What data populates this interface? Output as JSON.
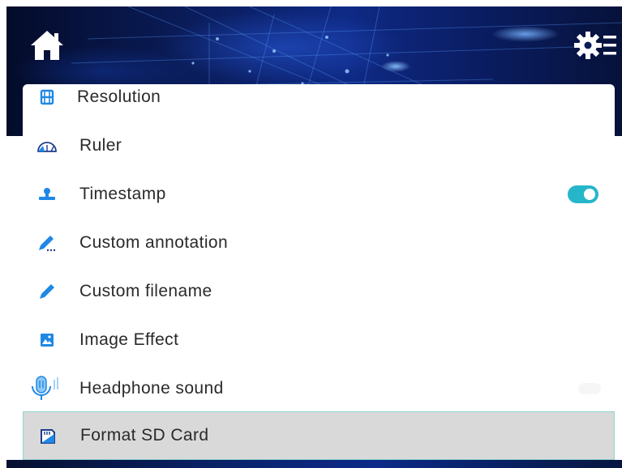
{
  "header": {
    "home_icon": "home-icon",
    "settings_icon": "settings-menu-icon"
  },
  "menu": {
    "items": [
      {
        "label": "Resolution",
        "icon": "film-icon"
      },
      {
        "label": "Ruler",
        "icon": "ruler-icon"
      },
      {
        "label": "Timestamp",
        "icon": "timestamp-icon",
        "toggle_on": true
      },
      {
        "label": "Custom annotation",
        "icon": "annotation-pen-icon"
      },
      {
        "label": "Custom filename",
        "icon": "pencil-icon"
      },
      {
        "label": "Image Effect",
        "icon": "image-icon"
      },
      {
        "label": "Headphone sound",
        "icon": "microphone-icon"
      },
      {
        "label": "Format SD Card",
        "icon": "sd-card-icon",
        "selected": true
      }
    ]
  },
  "colors": {
    "accent": "#1e88e5",
    "toggle_on": "#25b6c9",
    "selected_row": "#d9d9d9",
    "selected_border": "#8fd8cf"
  }
}
